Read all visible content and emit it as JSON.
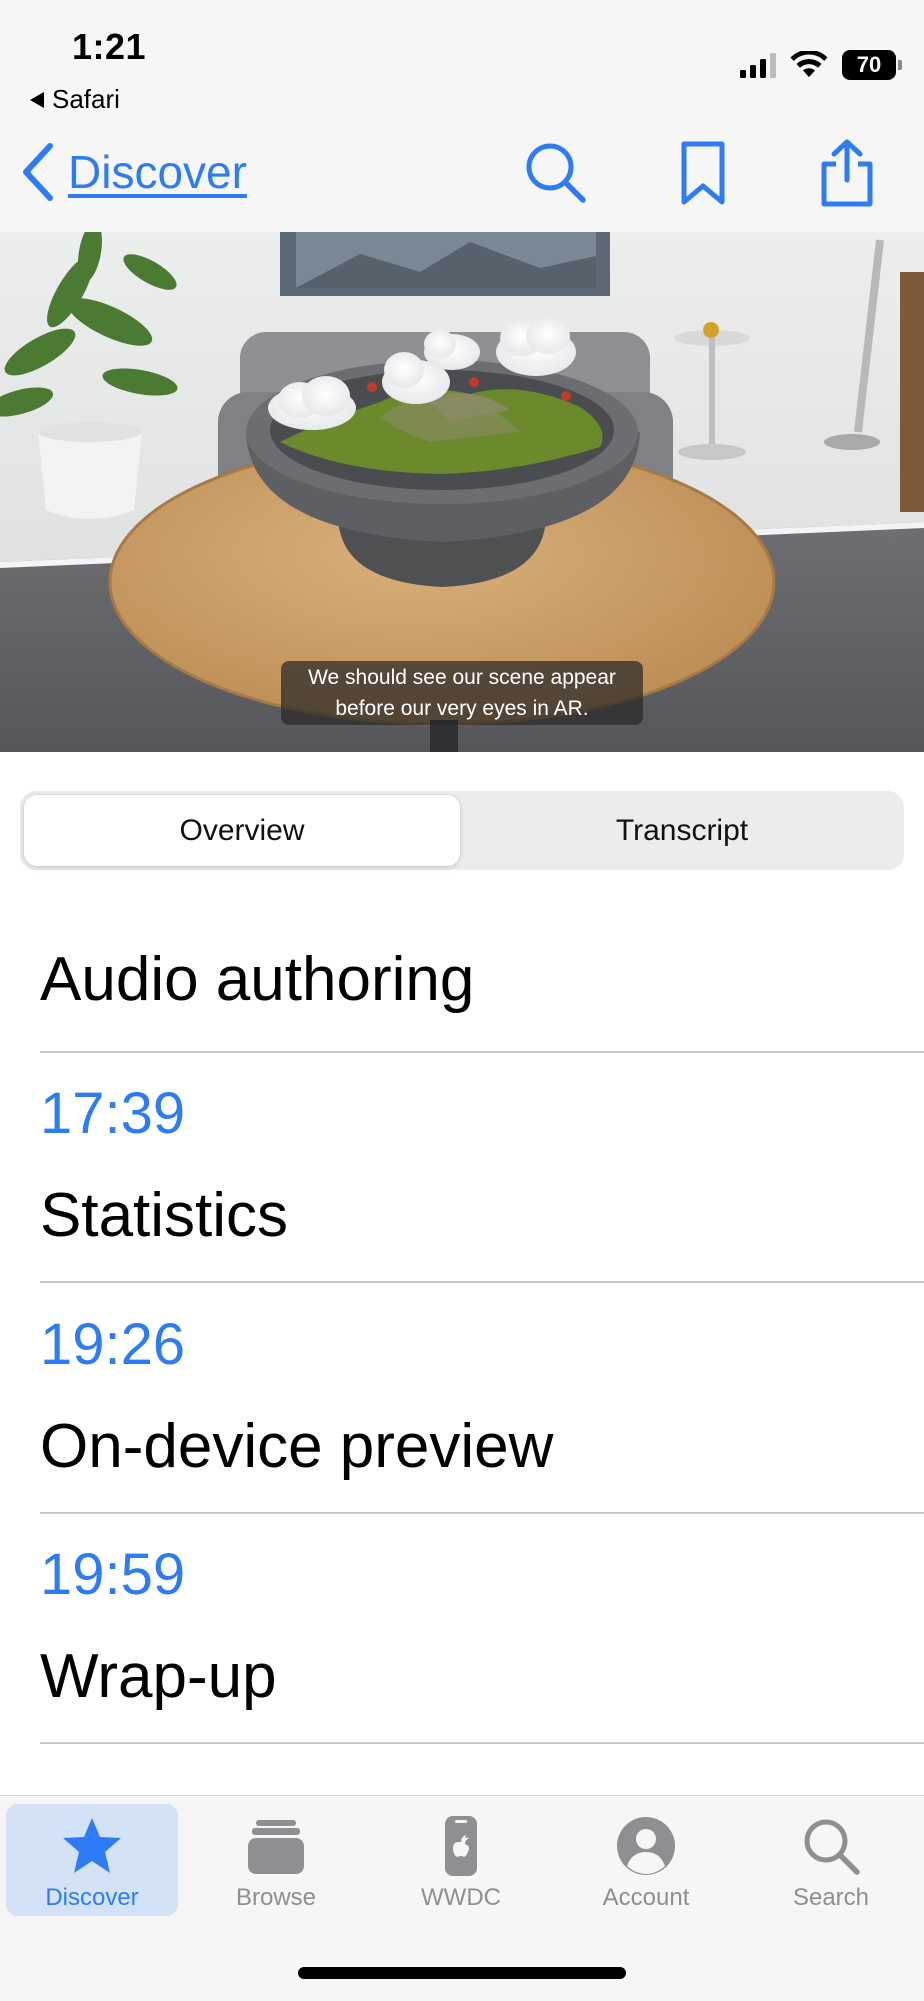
{
  "status_bar": {
    "time": "1:21",
    "back_app": "Safari",
    "battery": "70"
  },
  "nav": {
    "back_label": "Discover",
    "icons": [
      "search-icon",
      "bookmark-icon",
      "share-icon"
    ]
  },
  "video": {
    "caption_line1": "We should see our scene appear",
    "caption_line2": "before our very eyes in AR."
  },
  "segments": {
    "overview": "Overview",
    "transcript": "Transcript",
    "selected": "Overview"
  },
  "chapters": {
    "first_title": "Audio authoring",
    "items": [
      {
        "time": "17:39",
        "title": "Statistics"
      },
      {
        "time": "19:26",
        "title": "On-device preview"
      },
      {
        "time": "19:59",
        "title": "Wrap-up"
      }
    ]
  },
  "tab_bar": {
    "tabs": [
      {
        "label": "Discover",
        "icon": "star-icon"
      },
      {
        "label": "Browse",
        "icon": "stack-icon"
      },
      {
        "label": "WWDC",
        "icon": "apple-device-icon"
      },
      {
        "label": "Account",
        "icon": "person-icon"
      },
      {
        "label": "Search",
        "icon": "search-icon"
      }
    ],
    "selected": "Discover"
  },
  "colors": {
    "accent": "#2d7cf6",
    "bar_background": "#f6f6f7",
    "selected_tab_background": "#d3e2f6"
  }
}
